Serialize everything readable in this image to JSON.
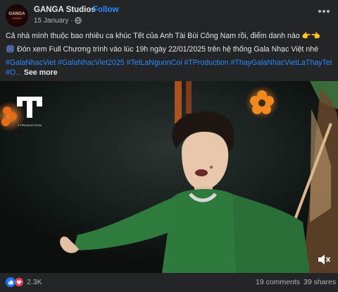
{
  "header": {
    "avatar_text": "GANGA",
    "avatar_subtext": "STUDIOS",
    "page_name": "GANGA Studios",
    "separator": "·",
    "follow_label": "Follow",
    "date": "15 January ·"
  },
  "caption": {
    "line1": "Cả nhà mình thuộc bao nhiêu ca khúc Tết của Anh Tài Bùi Công Nam rồi, điểm danh nào 👉👈",
    "line2": "🎆 Đón xem Full Chương trình vào lúc 19h ngày 22/01/2025 trên hệ thống Gala Nhạc Việt nhé"
  },
  "hashtags": {
    "items": [
      "#GalaNhacViet",
      "#GalaNhacViet2025",
      "#TetLaNguonCoi",
      "#TProduction",
      "#ThayGalaNhacVietLaThayTet"
    ],
    "truncated": "#O...",
    "see_more": "See more"
  },
  "video": {
    "watermark_letter": "T",
    "watermark_text": "T PRODUCTION"
  },
  "footer": {
    "reaction_count": "2.3K",
    "comments": "19 comments",
    "shares": "39 shares"
  },
  "colors": {
    "background": "#242526",
    "text": "#e4e6eb",
    "muted": "#b0b3b8",
    "link": "#2d88ff",
    "jacket": "#2f7a3d"
  },
  "icons": [
    "globe-icon",
    "more-options-icon",
    "mute-icon",
    "like-reaction-icon",
    "love-reaction-icon"
  ]
}
